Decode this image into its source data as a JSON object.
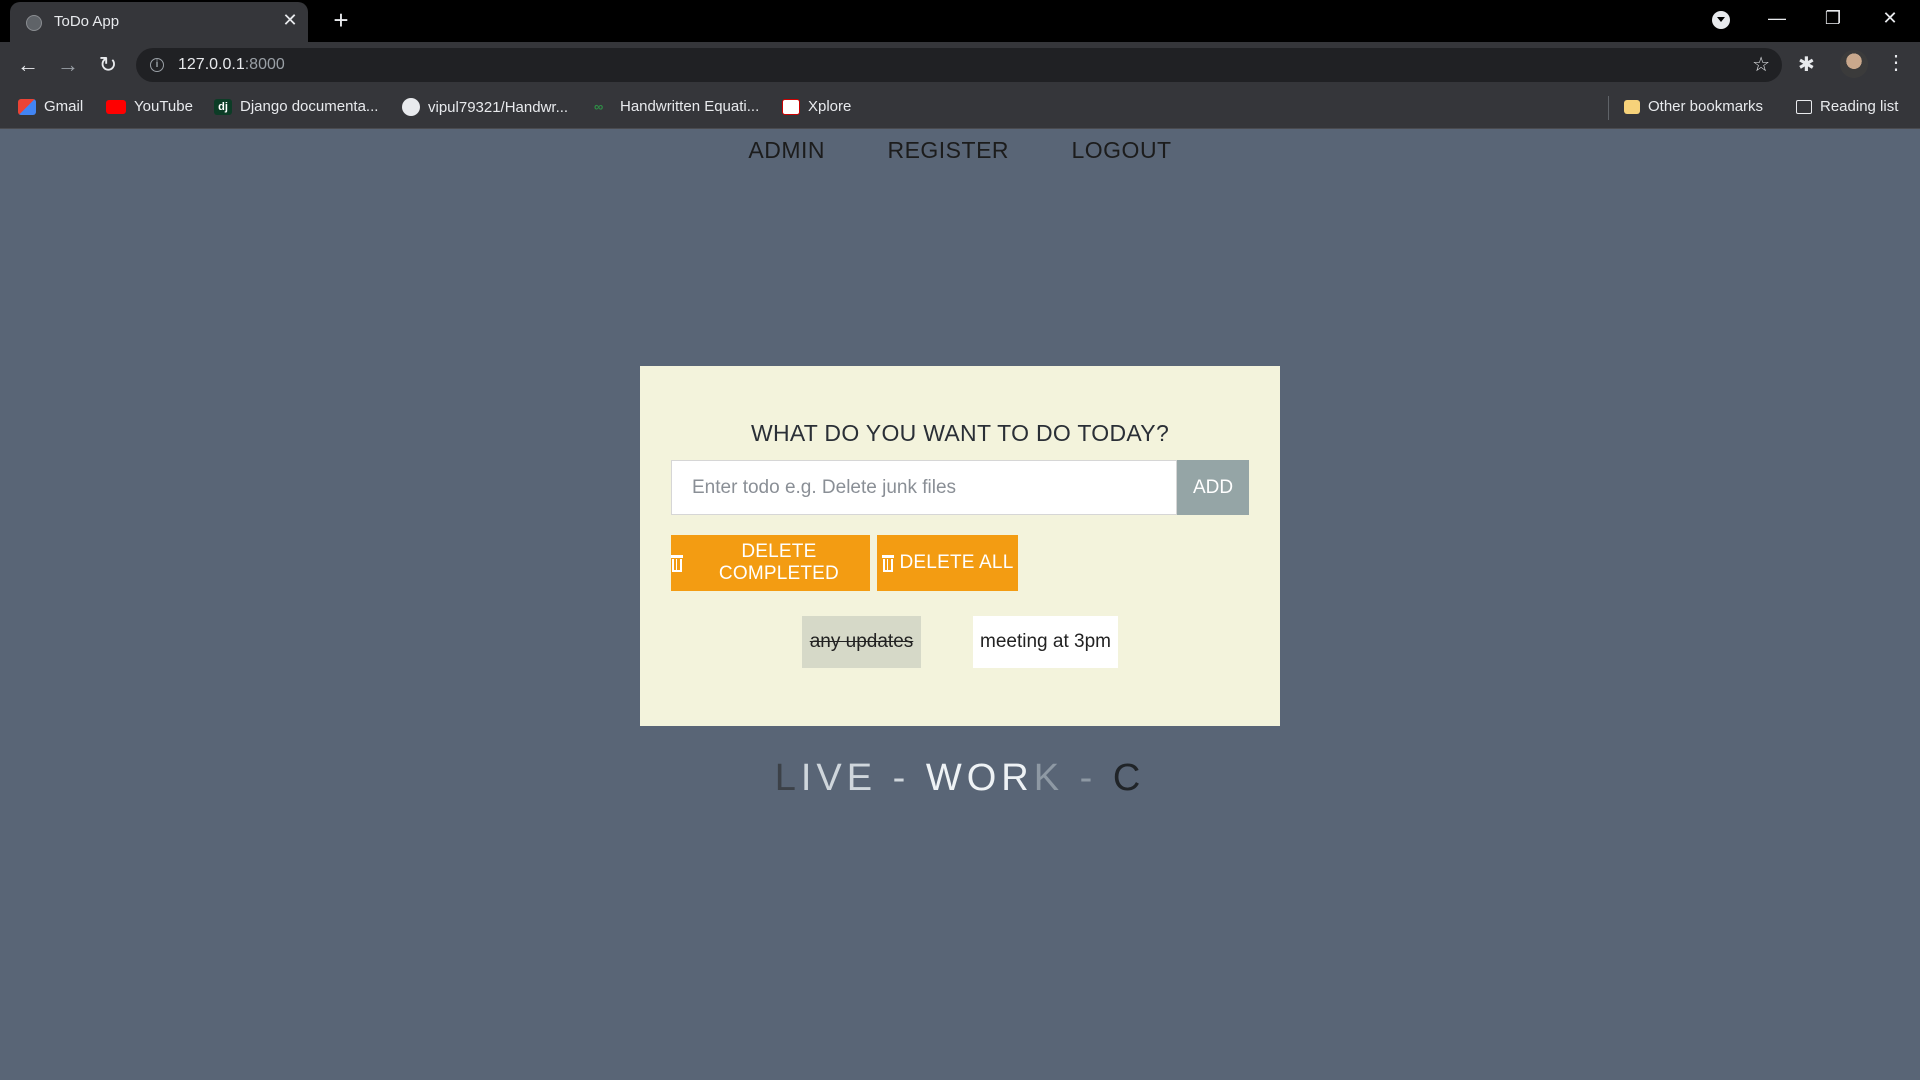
{
  "browser": {
    "tab_title": "ToDo App",
    "url_host": "127.0.0.1",
    "url_port": ":8000",
    "bookmarks": [
      {
        "label": "Gmail",
        "icon": "gmail-icon"
      },
      {
        "label": "YouTube",
        "icon": "youtube-icon"
      },
      {
        "label": "Django documenta...",
        "icon": "django-icon"
      },
      {
        "label": "vipul79321/Handwr...",
        "icon": "github-icon"
      },
      {
        "label": "Handwritten Equati...",
        "icon": "link-icon"
      },
      {
        "label": "Xplore",
        "icon": "ieee-icon"
      }
    ],
    "other_bookmarks": "Other bookmarks",
    "reading_list": "Reading list"
  },
  "nav": {
    "admin": "ADMIN",
    "register": "REGISTER",
    "logout": "LOGOUT"
  },
  "card": {
    "heading": "WHAT DO YOU WANT TO DO TODAY?",
    "input_placeholder": "Enter todo e.g. Delete junk files",
    "add_label": "ADD",
    "delete_completed_label": "DELETE COMPLETED",
    "delete_all_label": "DELETE ALL",
    "todos": [
      {
        "text": "any updates",
        "completed": true
      },
      {
        "text": "meeting at 3pm",
        "completed": false
      }
    ]
  },
  "tagline": {
    "part1": "L",
    "part2": "IVE - ",
    "part3": "WOR",
    "part4": "K - ",
    "part5": "C"
  },
  "colors": {
    "page_bg": "#596576",
    "card_bg": "#f3f3dc",
    "accent_orange": "#f39c12",
    "add_button": "#95a5a6"
  }
}
